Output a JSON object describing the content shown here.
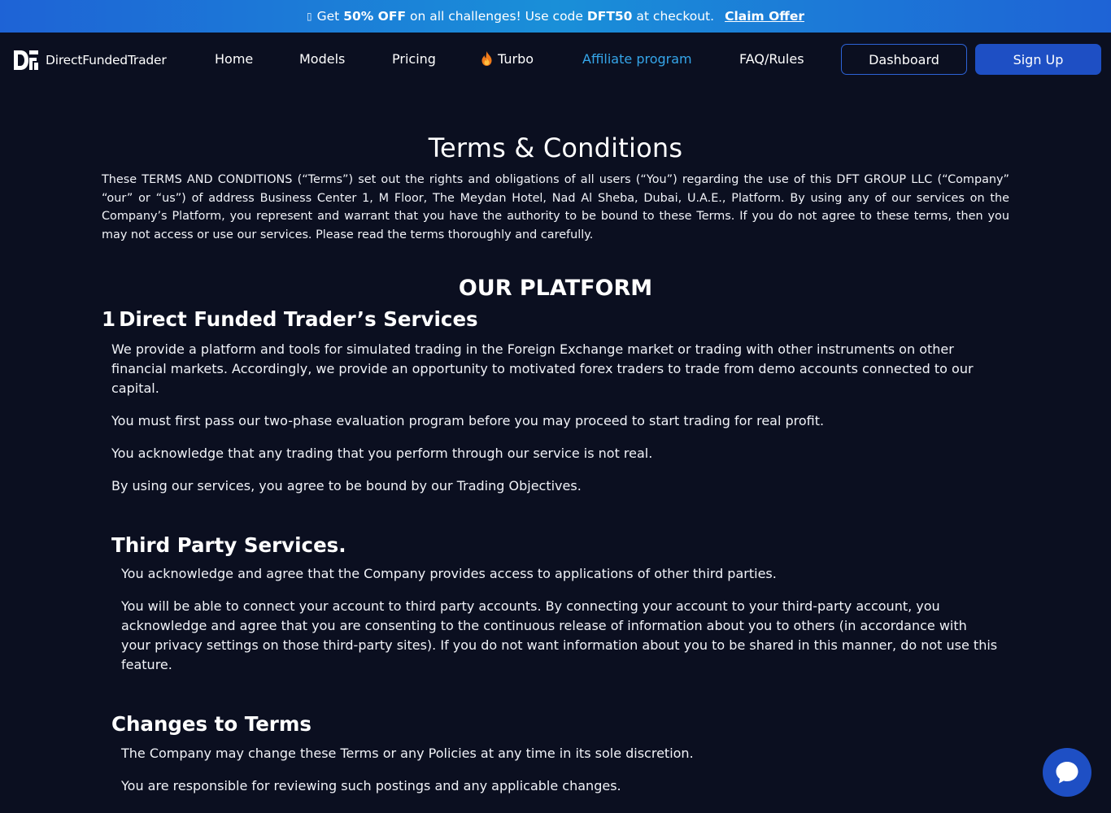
{
  "promo": {
    "icon": "gift-icon",
    "prefix": "Get",
    "highlight": "50% OFF",
    "middle": "on all challenges! Use code",
    "code": "DFT50",
    "suffix": "at checkout.",
    "claim_label": "Claim Offer"
  },
  "nav": {
    "brand": "DirectFundedTrader",
    "links": {
      "home": "Home",
      "models": "Models",
      "pricing": "Pricing",
      "turbo": "Turbo",
      "affiliate": "Affiliate program",
      "faq": "FAQ/Rules"
    },
    "dashboard_label": "Dashboard",
    "signup_label": "Sign Up",
    "colors": {
      "affiliate": "#35a6ea",
      "primary_button": "#1e4fc4",
      "background": "#0b0f20"
    }
  },
  "page": {
    "title": "Terms & Conditions",
    "intro": "These TERMS AND CONDITIONS (“Terms”) set out the rights and obligations of all users (“You”) regarding the use of this DFT GROUP LLC (“Company” “our” or “us”) of address Business Center 1, M Floor, The Meydan Hotel, Nad Al Sheba, Dubai, U.A.E., Platform. By using any of our services on the Company’s Platform, you represent and warrant that you have the authority to be bound to these Terms. If you do not agree to these terms, then you may not access or use our services. Please read the terms thoroughly and carefully.",
    "section_title": "OUR PLATFORM",
    "section1": {
      "number": "1",
      "title": "Direct Funded Trader’s Services",
      "paragraphs": [
        "We provide a platform and tools for simulated trading in the Foreign Exchange market or trading with other instruments on other financial markets. Accordingly, we provide an opportunity to motivated forex traders to trade from demo accounts connected to our capital.",
        "You must first pass our two-phase evaluation program before you may proceed to start trading for real profit.",
        "You acknowledge that any trading that you perform through our service is not real.",
        "By using our services, you agree to be bound by our Trading Objectives."
      ]
    },
    "third_party": {
      "title": "Third Party Services.",
      "paragraphs": [
        "You acknowledge and agree that the Company provides access to applications of other third parties.",
        "You will be able to connect your account to third party accounts. By connecting your account to your third-party account, you acknowledge and agree that you are consenting to the continuous release of information about you to others (in accordance with your privacy settings on those third-party sites). If you do not want information about you to be shared in this manner, do not use this feature."
      ]
    },
    "changes": {
      "title": "Changes to Terms",
      "paragraphs": [
        "The Company may change these Terms or any Policies at any time in its sole discretion.",
        "You are responsible for reviewing such postings and any applicable changes."
      ]
    }
  },
  "chat": {
    "icon": "chat-bubble-icon"
  }
}
